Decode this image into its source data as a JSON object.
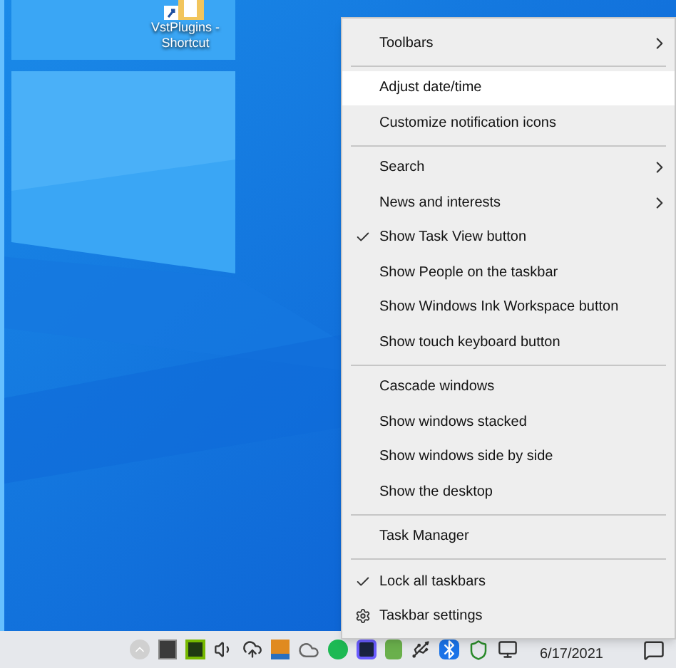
{
  "desktop": {
    "icons": [
      {
        "label": "VstPlugins - Shortcut"
      }
    ]
  },
  "context_menu": {
    "groups": [
      {
        "items": [
          {
            "label": "Toolbars",
            "kind": "text",
            "checked": false,
            "submenu": true,
            "selected": false
          }
        ]
      },
      {
        "items": [
          {
            "label": "Adjust date/time",
            "kind": "text",
            "checked": false,
            "submenu": false,
            "selected": true
          },
          {
            "label": "Customize notification icons",
            "kind": "text",
            "checked": false,
            "submenu": false,
            "selected": false
          }
        ]
      },
      {
        "items": [
          {
            "label": "Search",
            "kind": "text",
            "checked": false,
            "submenu": true,
            "selected": false
          },
          {
            "label": "News and interests",
            "kind": "text",
            "checked": false,
            "submenu": true,
            "selected": false
          },
          {
            "label": "Show Task View button",
            "kind": "text",
            "checked": true,
            "submenu": false,
            "selected": false
          },
          {
            "label": "Show People on the taskbar",
            "kind": "text",
            "checked": false,
            "submenu": false,
            "selected": false
          },
          {
            "label": "Show Windows Ink Workspace button",
            "kind": "text",
            "checked": false,
            "submenu": false,
            "selected": false
          },
          {
            "label": "Show touch keyboard button",
            "kind": "text",
            "checked": false,
            "submenu": false,
            "selected": false
          }
        ]
      },
      {
        "items": [
          {
            "label": "Cascade windows",
            "kind": "text",
            "checked": false,
            "submenu": false,
            "selected": false
          },
          {
            "label": "Show windows stacked",
            "kind": "text",
            "checked": false,
            "submenu": false,
            "selected": false
          },
          {
            "label": "Show windows side by side",
            "kind": "text",
            "checked": false,
            "submenu": false,
            "selected": false
          },
          {
            "label": "Show the desktop",
            "kind": "text",
            "checked": false,
            "submenu": false,
            "selected": false
          }
        ]
      },
      {
        "items": [
          {
            "label": "Task Manager",
            "kind": "text",
            "checked": false,
            "submenu": false,
            "selected": false
          }
        ]
      },
      {
        "items": [
          {
            "label": "Lock all taskbars",
            "kind": "text",
            "checked": true,
            "submenu": false,
            "selected": false
          },
          {
            "label": "Taskbar settings",
            "kind": "gear",
            "checked": false,
            "submenu": false,
            "selected": false
          }
        ]
      }
    ]
  },
  "taskbar": {
    "clock": {
      "date": "6/17/2021"
    }
  }
}
